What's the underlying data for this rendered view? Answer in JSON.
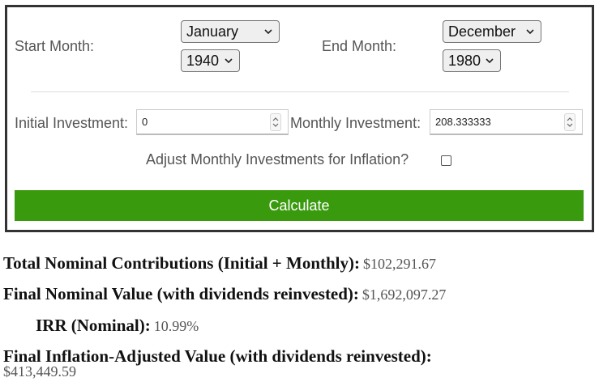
{
  "form": {
    "start_label": "Start Month:",
    "start_month": "January",
    "start_year": "1940",
    "end_label": "End Month:",
    "end_month": "December",
    "end_year": "1980",
    "initial_label": "Initial Investment:",
    "initial_value": "0",
    "monthly_label": "Monthly Investment:",
    "monthly_value": "208.333333",
    "inflation_label": "Adjust Monthly Investments for Inflation?",
    "calculate_label": "Calculate"
  },
  "results": {
    "total_label": "Total Nominal Contributions (Initial + Monthly):",
    "total_value": "$102,291.67",
    "final_label": "Final Nominal Value (with dividends reinvested):",
    "final_value": "$1,692,097.27",
    "irr_label": "IRR (Nominal):",
    "irr_value": "10.99%",
    "adjusted_label": "Final Inflation-Adjusted Value (with dividends reinvested):",
    "adjusted_value": "$413,449.59"
  },
  "colors": {
    "button": "#3a9a0e",
    "border": "#333333",
    "label": "#555555"
  },
  "icons": {
    "select_arrow": "chevron-down-icon",
    "spinner": "spinner-arrows-icon"
  }
}
